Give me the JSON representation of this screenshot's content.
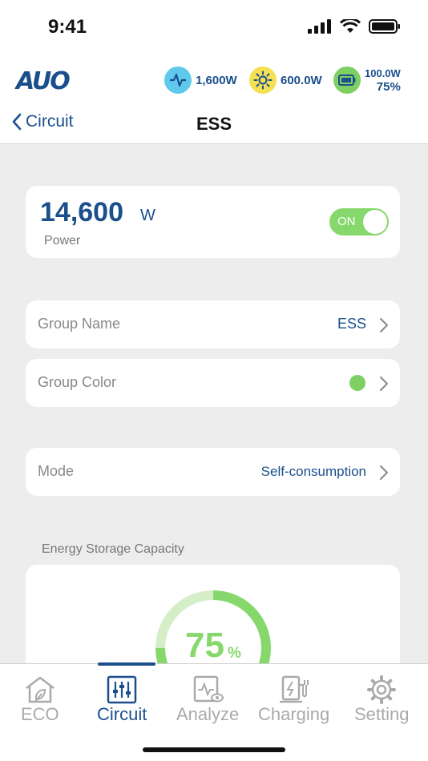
{
  "status_bar": {
    "time": "9:41"
  },
  "header": {
    "logo": "AUO",
    "grid_power": "1,600W",
    "solar_power": "600.0W",
    "battery_power": "100.0W",
    "battery_percent": "75%"
  },
  "nav": {
    "back_label": "Circuit",
    "title": "ESS"
  },
  "power_card": {
    "value": "14,600",
    "unit": "W",
    "label": "Power",
    "toggle_label": "ON",
    "toggle_on": true
  },
  "group_name": {
    "label": "Group Name",
    "value": "ESS"
  },
  "group_color": {
    "label": "Group Color",
    "color": "#7ed063"
  },
  "mode": {
    "label": "Mode",
    "value": "Self-consumption"
  },
  "capacity": {
    "section_title": "Energy Storage Capacity",
    "value": "75",
    "unit": "%",
    "fraction": 0.75
  },
  "tabs": [
    {
      "label": "ECO",
      "icon": "eco-house-icon",
      "active": false
    },
    {
      "label": "Circuit",
      "icon": "circuit-sliders-icon",
      "active": true
    },
    {
      "label": "Analyze",
      "icon": "analyze-monitor-icon",
      "active": false
    },
    {
      "label": "Charging",
      "icon": "charging-station-icon",
      "active": false
    },
    {
      "label": "Setting",
      "icon": "gear-icon",
      "active": false
    }
  ],
  "colors": {
    "brand": "#1a4f8c",
    "accent_green": "#86d86c",
    "grid_blue": "#5fc9ec",
    "solar_yellow": "#f5df52"
  }
}
